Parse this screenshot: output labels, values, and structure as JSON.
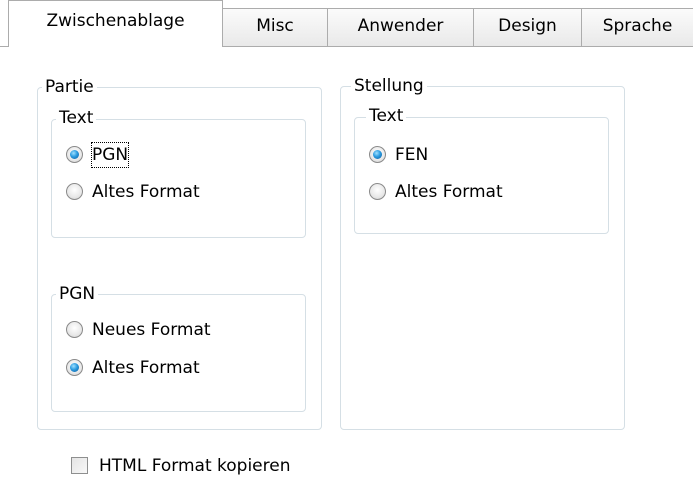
{
  "tabs": [
    {
      "label": "Zwischenablage",
      "active": true
    },
    {
      "label": "Misc",
      "active": false
    },
    {
      "label": "Anwender",
      "active": false
    },
    {
      "label": "Design",
      "active": false
    },
    {
      "label": "Sprache",
      "active": false
    }
  ],
  "partie": {
    "title": "Partie",
    "text_group": {
      "title": "Text",
      "options": [
        {
          "label": "PGN",
          "checked": true
        },
        {
          "label": "Altes Format",
          "checked": false
        }
      ]
    },
    "pgn_group": {
      "title": "PGN",
      "options": [
        {
          "label": "Neues Format",
          "checked": false
        },
        {
          "label": "Altes Format",
          "checked": true
        }
      ]
    }
  },
  "stellung": {
    "title": "Stellung",
    "text_group": {
      "title": "Text",
      "options": [
        {
          "label": "FEN",
          "checked": true
        },
        {
          "label": "Altes Format",
          "checked": false
        }
      ]
    }
  },
  "html_copy": {
    "label": "HTML Format kopieren",
    "checked": false
  },
  "colors": {
    "radio_selected": "#2b9be0",
    "group_border": "#d5dfe5",
    "tab_border": "#acacac"
  }
}
